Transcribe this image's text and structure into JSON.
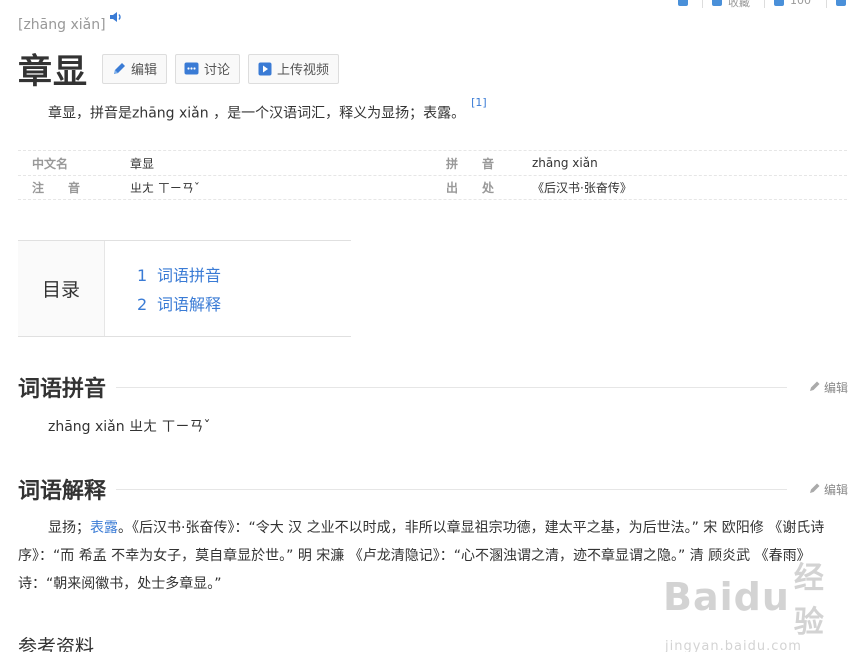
{
  "entry": {
    "pinyin": "[zhāng xiǎn]",
    "title": "章显",
    "buttons": {
      "edit": "编辑",
      "discuss": "讨论",
      "upload_video": "上传视频"
    },
    "summary": "章显，拼音是zhāng xiǎn ，是一个汉语词汇，释义为显扬；表露。",
    "summary_ref": "[1]"
  },
  "basic_info": [
    {
      "name": "中文名",
      "value": "章显",
      "name2": "拼　　音",
      "value2": "zhāng xiǎn"
    },
    {
      "name": "注　　音",
      "value": "ㄓㄤ ㄒㄧㄢˇ",
      "name2": "出　　处",
      "value2": "《后汉书·张奋传》"
    }
  ],
  "catalog": {
    "title": "目录",
    "items": [
      {
        "num": "1",
        "label": "词语拼音"
      },
      {
        "num": "2",
        "label": "词语解释"
      }
    ]
  },
  "sections": {
    "pinyin": {
      "title": "词语拼音",
      "edit": "编辑",
      "content": "zhāng xiǎn ㄓㄤ ㄒㄧㄢˇ"
    },
    "explain": {
      "title": "词语解释",
      "edit": "编辑",
      "text_before": "显扬；",
      "link": "表露",
      "text_after": "。《后汉书·张奋传》：“令大 汉 之业不以时成，非所以章显祖宗功德，建太平之基，为后世法。” 宋 欧阳修 《谢氏诗序》：“而 希孟 不幸为女子，莫自章显於世。” 明 宋濂 《卢龙清隐记》：“心不溷浊谓之清，迹不章显谓之隐。” 清 顾炎武 《春雨》诗：“朝来阅徽书，处士多章显。”"
    }
  },
  "references": {
    "title": "参考资料"
  },
  "watermark": {
    "logo": "Baidu",
    "cn": "经验",
    "url": "jingyan.baidu.com"
  },
  "top_bar": {
    "item1": "收藏",
    "item2": "100"
  },
  "colors": {
    "link": "#3a7bd5",
    "text": "#333333",
    "label": "#999999"
  }
}
